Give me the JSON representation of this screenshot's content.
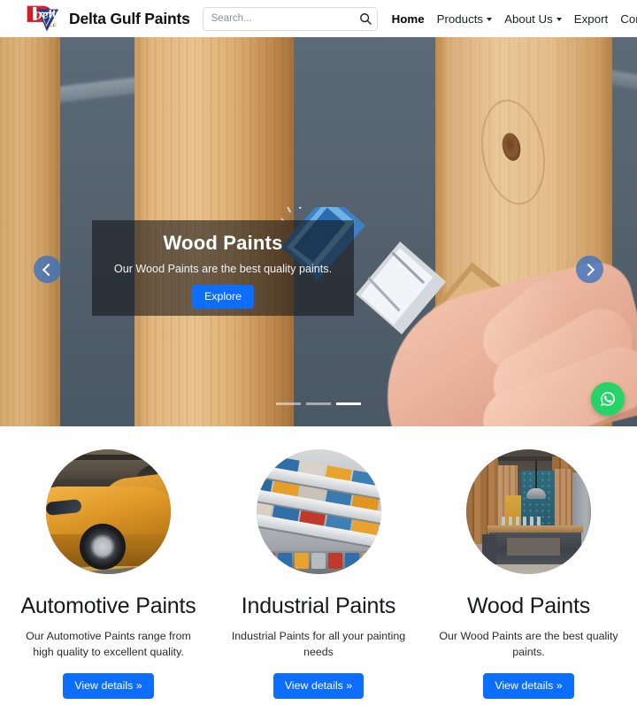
{
  "navbar": {
    "brand_name": "Delta Gulf Paints",
    "logo_icon": "delta-gulf-paints-logo",
    "logo_script_text": "Delta",
    "search": {
      "placeholder": "Search...",
      "value": "",
      "button_icon": "search-icon"
    },
    "links": [
      {
        "label": "Home",
        "active": true,
        "has_dropdown": false
      },
      {
        "label": "Products",
        "active": false,
        "has_dropdown": true
      },
      {
        "label": "About Us",
        "active": false,
        "has_dropdown": true
      },
      {
        "label": "Export",
        "active": false,
        "has_dropdown": false
      },
      {
        "label": "Contact Us",
        "active": false,
        "has_dropdown": false
      }
    ]
  },
  "hero": {
    "slide": {
      "title": "Wood Paints",
      "text": "Our Wood Paints are the best quality paints.",
      "button_label": "Explore",
      "image_alt": "hand-painting-wooden-planks-with-blue-paintbrush"
    },
    "prev_icon": "chevron-left-icon",
    "next_icon": "chevron-right-icon",
    "indicators": [
      {
        "active": false
      },
      {
        "active": false
      },
      {
        "active": true
      }
    ],
    "whatsapp": {
      "icon": "whatsapp-icon",
      "color": "#25d366"
    }
  },
  "cards": [
    {
      "title": "Automotive Paints",
      "text": "Our Automotive Paints range from high quality to excellent quality.",
      "button_label": "View details »",
      "image_alt": "golden-sports-car-in-garage"
    },
    {
      "title": "Industrial Paints",
      "text": "Industrial Paints for all your painting needs",
      "button_label": "View details »",
      "image_alt": "paint-store-shelves-with-color-samples"
    },
    {
      "title": "Wood Paints",
      "text": "Our Wood Paints are the best quality paints.",
      "button_label": "View details »",
      "image_alt": "wood-workshop-with-workbench"
    }
  ],
  "colors": {
    "primary": "#0d6efd",
    "whatsapp_green": "#25d366",
    "logo_red": "#d11f26",
    "logo_blue": "#1d3a8f"
  }
}
